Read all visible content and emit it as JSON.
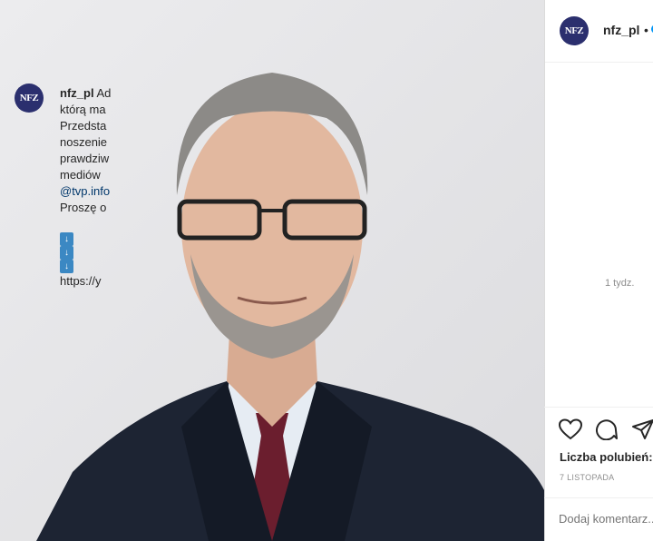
{
  "post": {
    "username": "nfz_pl",
    "avatar_text": "NFZ",
    "dot": "•",
    "caption": {
      "username": "nfz_pl",
      "lines": [
        "Ad",
        "którą ma",
        "Przedsta",
        "noszenie",
        "prawdziw",
        "mediów",
        "@tvp.info",
        "Proszę o"
      ],
      "arrows": [
        "↓",
        "↓",
        "↓"
      ],
      "link": "https://y"
    },
    "time_ago": "1 tydz.",
    "likes_label": "Liczba polubień:",
    "date": "7 LISTOPADA",
    "comment_placeholder": "Dodaj komentarz..."
  },
  "icons": {
    "like": "heart-icon",
    "comment": "comment-bubble-icon",
    "share": "paper-plane-icon",
    "verified": "verified-badge-icon"
  },
  "colors": {
    "verified": "#0095f6",
    "avatar_bg": "#2b2f6e",
    "mention": "#00376b",
    "secondary_text": "#8e8e8e"
  }
}
